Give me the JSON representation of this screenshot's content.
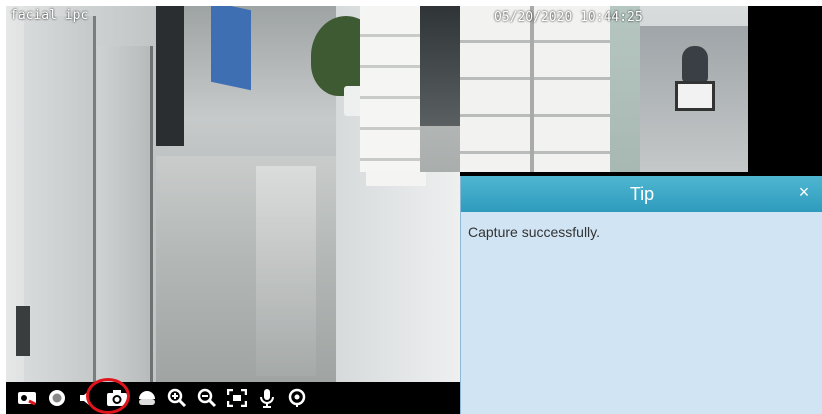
{
  "video": {
    "camera_label": "facial ipc",
    "timestamp": "05/20/2020 10:44:25"
  },
  "toolbar": {
    "buttons": [
      {
        "icon": "close-stream-icon",
        "label": ""
      },
      {
        "icon": "record-icon",
        "label": ""
      },
      {
        "icon": "volume-icon",
        "label": ""
      },
      {
        "icon": "camera-capture-icon",
        "label": "",
        "highlighted": true
      },
      {
        "icon": "ptz-icon",
        "label": ""
      },
      {
        "icon": "zoom-in-icon",
        "label": ""
      },
      {
        "icon": "zoom-out-icon",
        "label": ""
      },
      {
        "icon": "fullscreen-icon",
        "label": ""
      },
      {
        "icon": "microphone-icon",
        "label": ""
      },
      {
        "icon": "location-pin-icon",
        "label": ""
      }
    ],
    "highlight_color": "#e0141c"
  },
  "tip": {
    "title": "Tip",
    "close_label": "×",
    "message": "Capture successfully.",
    "header_color": "#3aa8c8",
    "body_color": "#d0e4f4"
  }
}
